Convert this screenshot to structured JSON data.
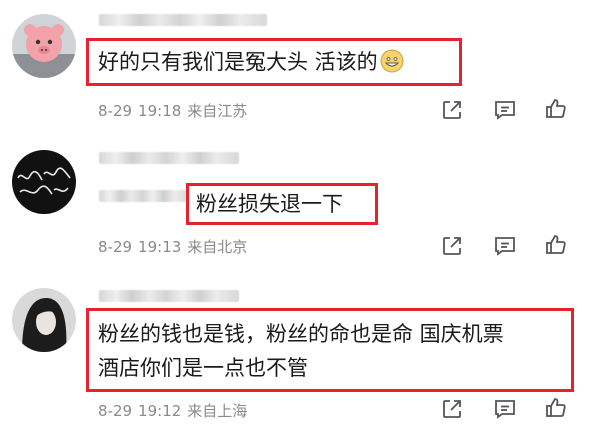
{
  "comments": [
    {
      "text": "好的只有我们是冤大头 活该的",
      "emoji": "face-with-wide-smile-icon",
      "date": "8-29",
      "time": "19:18",
      "location": "来自江苏"
    },
    {
      "text": "粉丝损失退一下",
      "date": "8-29",
      "time": "19:13",
      "location": "来自北京"
    },
    {
      "line1": "粉丝的钱也是钱，粉丝的命也是命 国庆机票",
      "line2": "酒店你们是一点也不管",
      "date": "8-29",
      "time": "19:12",
      "location": "来自上海"
    }
  ],
  "actions": [
    "share-icon",
    "comment-icon",
    "like-icon"
  ],
  "colors": {
    "highlight": "#e8212e",
    "meta_text": "#8a8a8a",
    "comment_text": "#1a1a1a"
  }
}
